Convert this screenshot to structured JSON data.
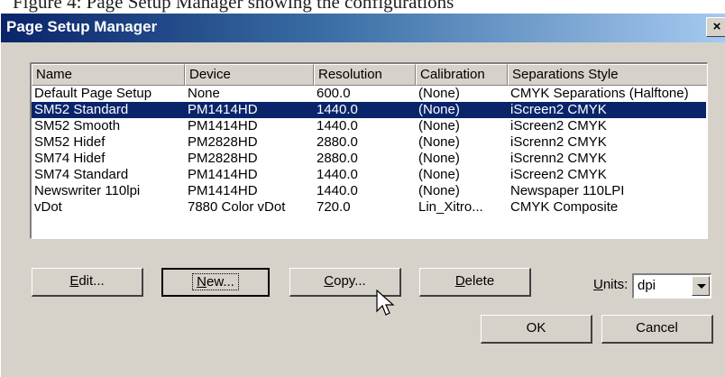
{
  "caption": "Figure 4: Page Setup Manager showing the configurations",
  "window": {
    "title": "Page Setup Manager",
    "close_glyph": "×"
  },
  "list": {
    "columns": [
      "Name",
      "Device",
      "Resolution",
      "Calibration",
      "Separations Style"
    ],
    "rows": [
      {
        "name": "Default Page Setup",
        "device": "None",
        "resolution": "600.0",
        "calibration": "(None)",
        "separations": "CMYK Separations (Halftone)",
        "selected": false
      },
      {
        "name": "SM52 Standard",
        "device": "PM1414HD",
        "resolution": "1440.0",
        "calibration": "(None)",
        "separations": "iScreen2 CMYK",
        "selected": true
      },
      {
        "name": "SM52 Smooth",
        "device": "PM1414HD",
        "resolution": "1440.0",
        "calibration": "(None)",
        "separations": "iScreen2 CMYK",
        "selected": false
      },
      {
        "name": "SM52 Hidef",
        "device": "PM2828HD",
        "resolution": "2880.0",
        "calibration": "(None)",
        "separations": "iScrenn2 CMYK",
        "selected": false
      },
      {
        "name": "SM74 Hidef",
        "device": "PM2828HD",
        "resolution": "2880.0",
        "calibration": "(None)",
        "separations": "iScrenn2 CMYK",
        "selected": false
      },
      {
        "name": "SM74 Standard",
        "device": "PM1414HD",
        "resolution": "1440.0",
        "calibration": "(None)",
        "separations": "iScreen2 CMYK",
        "selected": false
      },
      {
        "name": "Newswriter 110lpi",
        "device": "PM1414HD",
        "resolution": "1440.0",
        "calibration": "(None)",
        "separations": "Newspaper 110LPI",
        "selected": false
      },
      {
        "name": "vDot",
        "device": "7880 Color vDot",
        "resolution": "720.0",
        "calibration": "Lin_Xitro...",
        "separations": "CMYK Composite",
        "selected": false
      }
    ]
  },
  "buttons": {
    "edit": {
      "mnemonic": "E",
      "rest": "dit..."
    },
    "new": {
      "mnemonic": "N",
      "rest": "ew..."
    },
    "copy": {
      "mnemonic": "C",
      "rest": "opy..."
    },
    "delete": {
      "mnemonic": "D",
      "rest": "elete"
    },
    "ok": "OK",
    "cancel": "Cancel"
  },
  "units": {
    "label_mnemonic": "U",
    "label_rest": "nits:",
    "value": "dpi"
  },
  "colors": {
    "selection": "#0a246a",
    "dialog": "#d6d2ca",
    "title_start": "#0a246a",
    "title_end": "#a6caf0"
  },
  "icons": {
    "close": "close-icon",
    "dropdown": "chevron-down-icon",
    "cursor": "mouse-pointer-icon"
  }
}
